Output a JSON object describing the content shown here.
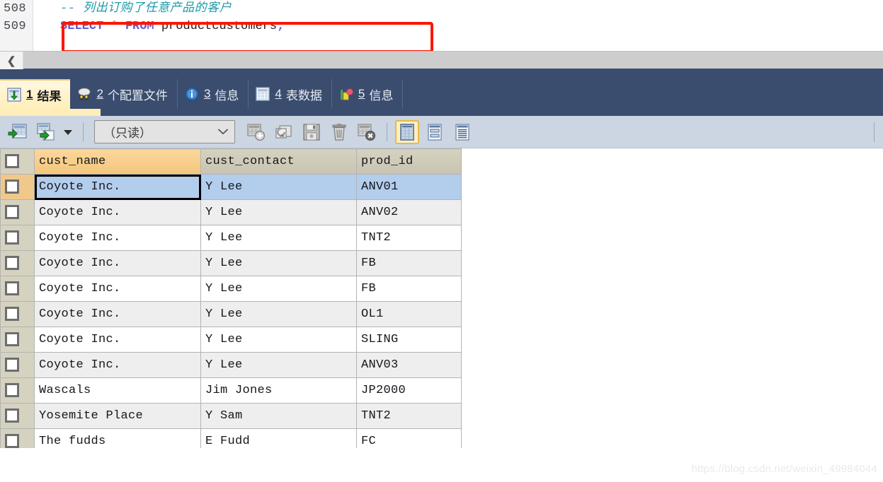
{
  "editor": {
    "line_numbers": [
      "508",
      "509"
    ],
    "comment_line": "-- 列出订购了任意产品的客户",
    "sql": {
      "keyword1": "SELECT",
      "star": "*",
      "keyword2": "FROM",
      "table": "productcustomers",
      "semicolon": ";"
    },
    "scroll_left_arrow": "❮"
  },
  "annotation": {
    "highlight_color": "#fc1605"
  },
  "tabs": [
    {
      "num": "1",
      "label": "结果",
      "icon": "grid-download-icon",
      "active": true
    },
    {
      "num": "2",
      "label": "个配置文件",
      "icon": "profile-icon",
      "active": false
    },
    {
      "num": "3",
      "label": "信息",
      "icon": "info-icon",
      "active": false
    },
    {
      "num": "4",
      "label": "表数据",
      "icon": "table-icon",
      "active": false
    },
    {
      "num": "5",
      "label": "信息",
      "icon": "chart-icon",
      "active": false
    }
  ],
  "toolbar": {
    "export_grid_label": "export-grid",
    "export_grid_more_label": "export-grid-more",
    "mode_value": "（只读）",
    "mode_chevron": "⌵",
    "add_record_label": "add-record",
    "revert_label": "revert-record",
    "save_label": "apply-changes",
    "delete_label": "delete-record",
    "cancel_label": "cancel-changes",
    "view_grid_label": "grid-view",
    "view_form_label": "form-view",
    "view_text_label": "text-view"
  },
  "grid": {
    "columns": [
      "cust_name",
      "cust_contact",
      "prod_id"
    ],
    "active_column": "cust_name",
    "selected_row_index": 0,
    "focused_cell": {
      "row": 0,
      "col": 0
    },
    "rows": [
      [
        "Coyote Inc.",
        "Y Lee",
        "ANV01"
      ],
      [
        "Coyote Inc.",
        "Y Lee",
        "ANV02"
      ],
      [
        "Coyote Inc.",
        "Y Lee",
        "TNT2"
      ],
      [
        "Coyote Inc.",
        "Y Lee",
        "FB"
      ],
      [
        "Coyote Inc.",
        "Y Lee",
        "FB"
      ],
      [
        "Coyote Inc.",
        "Y Lee",
        "OL1"
      ],
      [
        "Coyote Inc.",
        "Y Lee",
        "SLING"
      ],
      [
        "Coyote Inc.",
        "Y Lee",
        "ANV03"
      ],
      [
        "Wascals",
        "Jim Jones",
        "JP2000"
      ],
      [
        "Yosemite Place",
        "Y Sam",
        "TNT2"
      ],
      [
        "The fudds",
        "E Fudd",
        "FC"
      ]
    ]
  },
  "watermark": {
    "text": "https://blog.csdn.net/weixin_49984044"
  }
}
